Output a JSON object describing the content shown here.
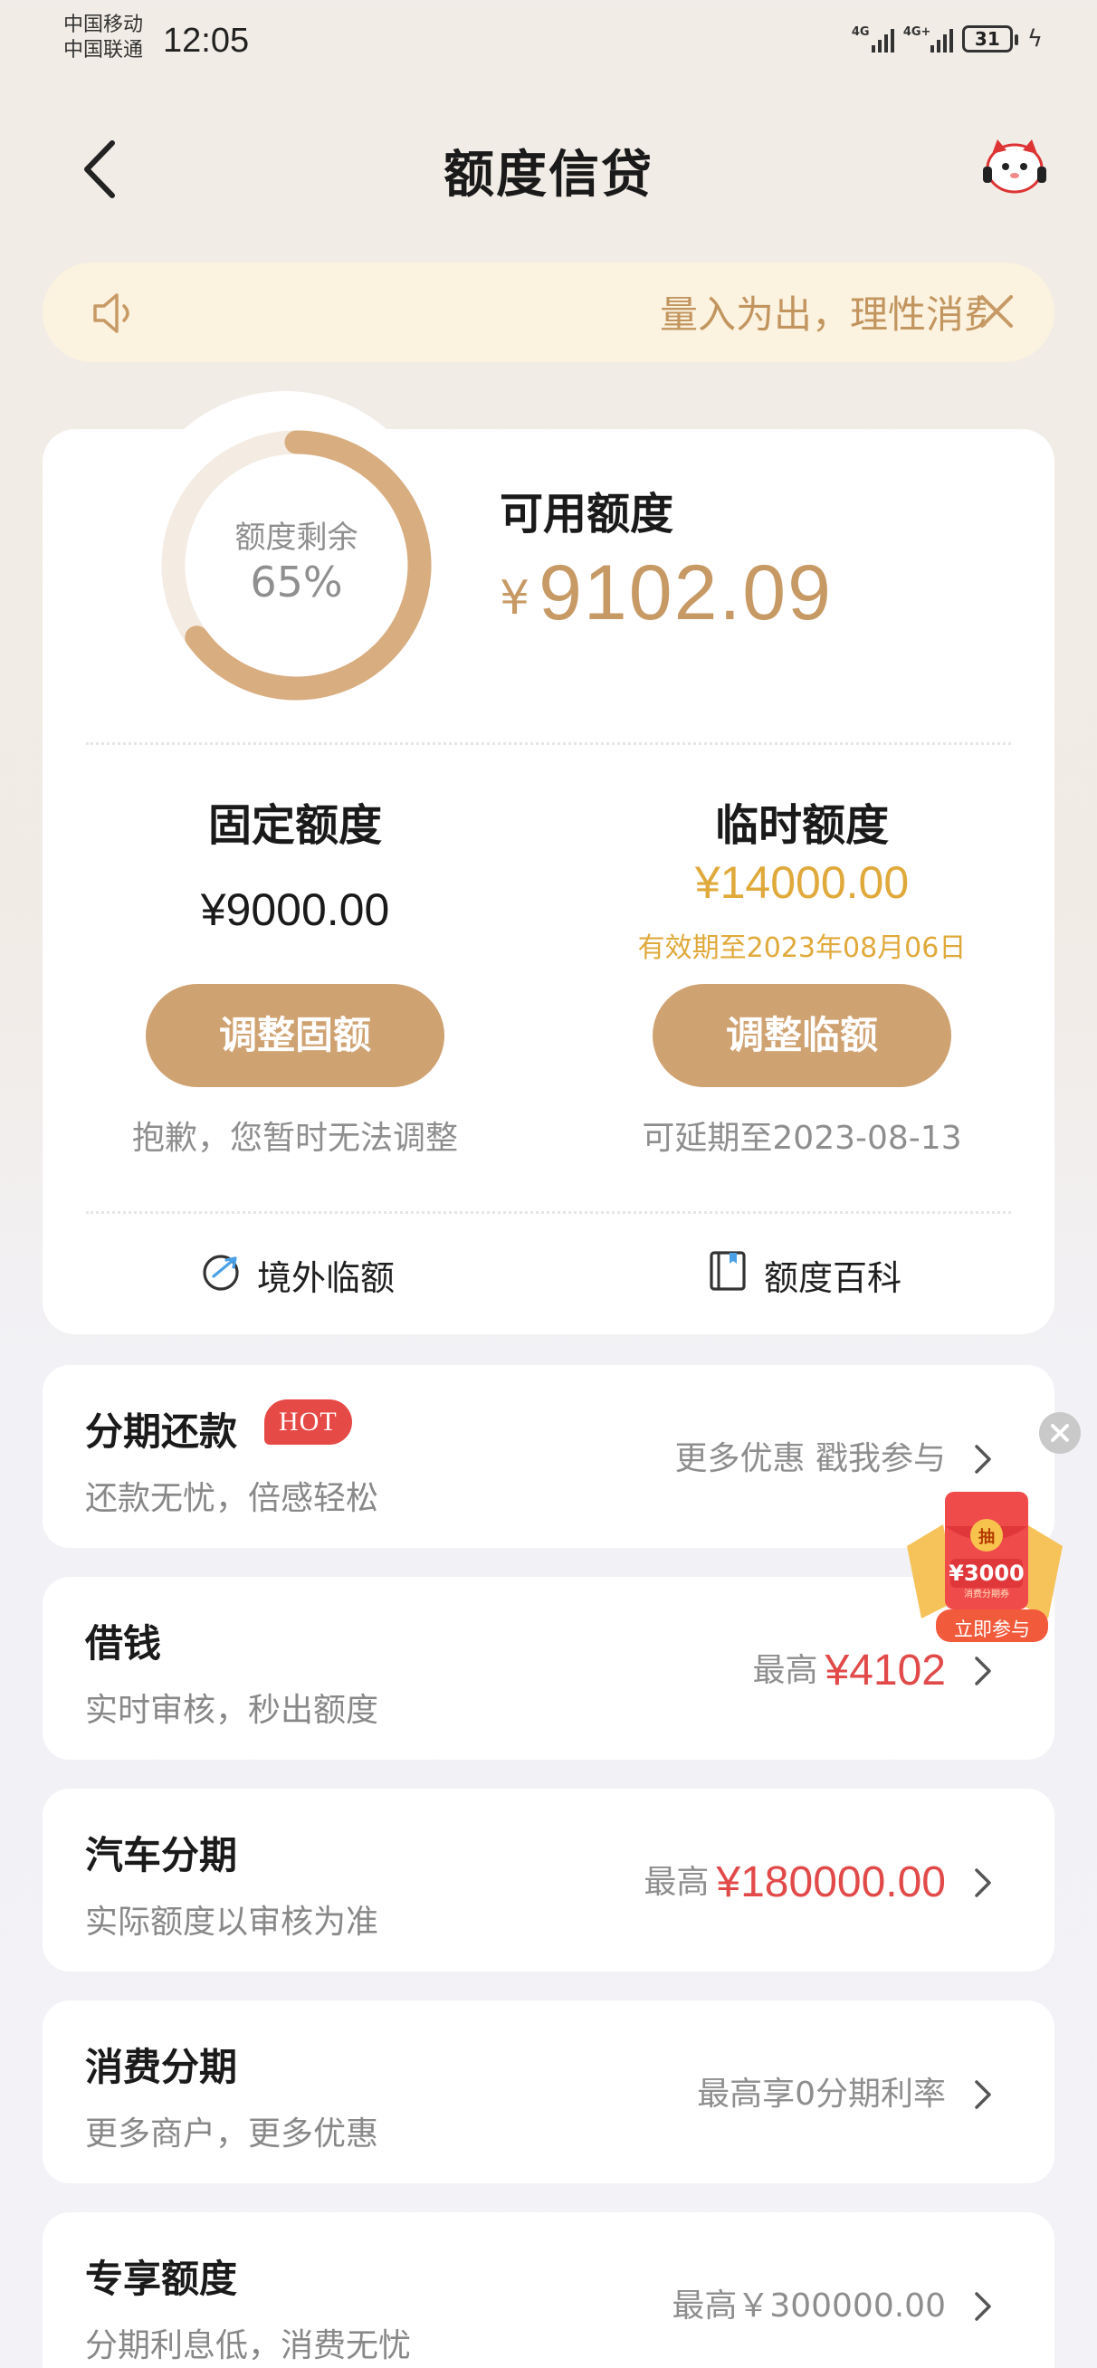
{
  "status_bar": {
    "carrier1": "中国移动",
    "carrier2": "中国联通",
    "time": "12:05",
    "network1": "4G",
    "network2": "4G+",
    "battery": "31"
  },
  "header": {
    "title": "额度信贷"
  },
  "notice": {
    "text": "量入为出，理性消费"
  },
  "credit": {
    "ring_label": "额度剩余",
    "ring_value": "65%",
    "remaining_fraction": 0.65,
    "available_label": "可用额度",
    "available_currency": "¥",
    "available_amount": "9102.09",
    "fixed": {
      "title": "固定额度",
      "amount": "¥9000.00",
      "button": "调整固额",
      "note": "抱歉，您暂时无法调整"
    },
    "temp": {
      "title": "临时额度",
      "amount": "¥14000.00",
      "valid": "有效期至2023年08月06日",
      "button": "调整临额",
      "note": "可延期至2023-08-13"
    },
    "links": {
      "overseas": "境外临额",
      "wiki": "额度百科"
    }
  },
  "list": [
    {
      "title": "分期还款",
      "badge": "HOT",
      "subtitle": "还款无忧，倍感轻松",
      "right_prefix": "更多优惠 戳我参与",
      "right_value": ""
    },
    {
      "title": "借钱",
      "subtitle": "实时审核，秒出额度",
      "right_prefix": "最高",
      "right_value": "¥4102"
    },
    {
      "title": "汽车分期",
      "subtitle": "实际额度以审核为准",
      "right_prefix": "最高",
      "right_value": "¥180000.00"
    },
    {
      "title": "消费分期",
      "subtitle": "更多商户，更多优惠",
      "right_prefix": "最高享0分期利率",
      "right_value": ""
    },
    {
      "title": "专享额度",
      "subtitle": "分期利息低，消费无忧",
      "right_prefix": "最高￥300000.00",
      "right_value": ""
    }
  ],
  "promo": {
    "tag": "抽",
    "amount": "¥3000",
    "small": "消费分期券",
    "cta": "立即参与"
  },
  "colors": {
    "gold": "#cfa271",
    "amount_gold": "#c79a65",
    "temp_yellow": "#e0a93b",
    "red": "#e24a4a",
    "hot": "#e64a47"
  }
}
